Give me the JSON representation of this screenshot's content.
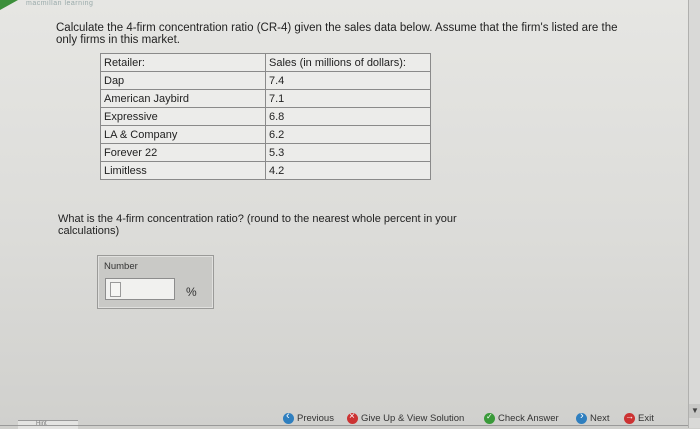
{
  "brand": {
    "text": "macmillan learning"
  },
  "question": {
    "prompt": "Calculate the 4-firm concentration ratio (CR-4) given the sales data below. Assume that the firm's listed are the only firms in this market."
  },
  "table": {
    "headers": [
      "Retailer:",
      "Sales (in millions of dollars):"
    ],
    "rows": [
      [
        "Dap",
        "7.4"
      ],
      [
        "American Jaybird",
        "7.1"
      ],
      [
        "Expressive",
        "6.8"
      ],
      [
        "LA & Company",
        "6.2"
      ],
      [
        "Forever 22",
        "5.3"
      ],
      [
        "Limitless",
        "4.2"
      ]
    ]
  },
  "question2": {
    "text": "What is the 4-firm concentration ratio? (round to the nearest whole percent in your calculations)"
  },
  "answer": {
    "label": "Number",
    "value": "",
    "unit": "%"
  },
  "nav": {
    "hint": "Hint",
    "previous": "Previous",
    "give_up": "Give Up & View Solution",
    "check": "Check Answer",
    "next": "Next",
    "exit": "Exit"
  }
}
